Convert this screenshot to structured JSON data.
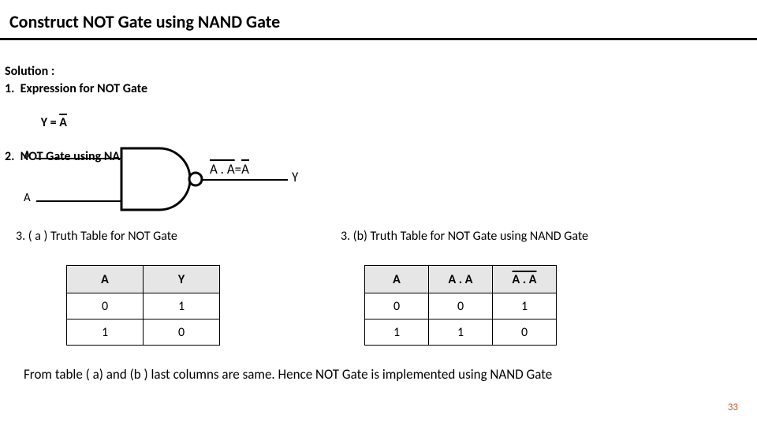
{
  "title": "Construct NOT Gate using NAND Gate",
  "solution_heading": "Solution :",
  "step1_prefix": "1.  Expression for NOT Gate",
  "step1_eq_lhs": "Y = ",
  "step1_eq_rhs": "A",
  "step2": "2.  NOT Gate using NAND Gate",
  "gate": {
    "in_top": "A",
    "in_bot": "A",
    "expr_lhs": "A . A",
    "expr_eq": " = ",
    "expr_rhs": "A",
    "out_label": "Y"
  },
  "sec_a": "3.   ( a ) Truth Table for NOT Gate",
  "sec_b": "3.   (b) Truth Table for NOT Gate using NAND Gate",
  "table_a": {
    "headers": [
      "A",
      "Y"
    ],
    "rows": [
      [
        "0",
        "1"
      ],
      [
        "1",
        "0"
      ]
    ]
  },
  "table_b": {
    "headers_plain": [
      "A",
      "A . A"
    ],
    "header_over": "A . A",
    "rows": [
      [
        "0",
        "0",
        "1"
      ],
      [
        "1",
        "1",
        "0"
      ]
    ]
  },
  "conclusion": "From table ( a) and (b ) last columns are same. Hence NOT Gate is implemented using NAND Gate",
  "page_number": "33",
  "chart_data": [
    {
      "type": "table",
      "title": "Truth Table for NOT Gate",
      "columns": [
        "A",
        "Y"
      ],
      "rows": [
        [
          0,
          1
        ],
        [
          1,
          0
        ]
      ]
    },
    {
      "type": "table",
      "title": "Truth Table for NOT Gate using NAND Gate",
      "columns": [
        "A",
        "A.A",
        "NOT(A.A)"
      ],
      "rows": [
        [
          0,
          0,
          1
        ],
        [
          1,
          1,
          0
        ]
      ]
    }
  ]
}
